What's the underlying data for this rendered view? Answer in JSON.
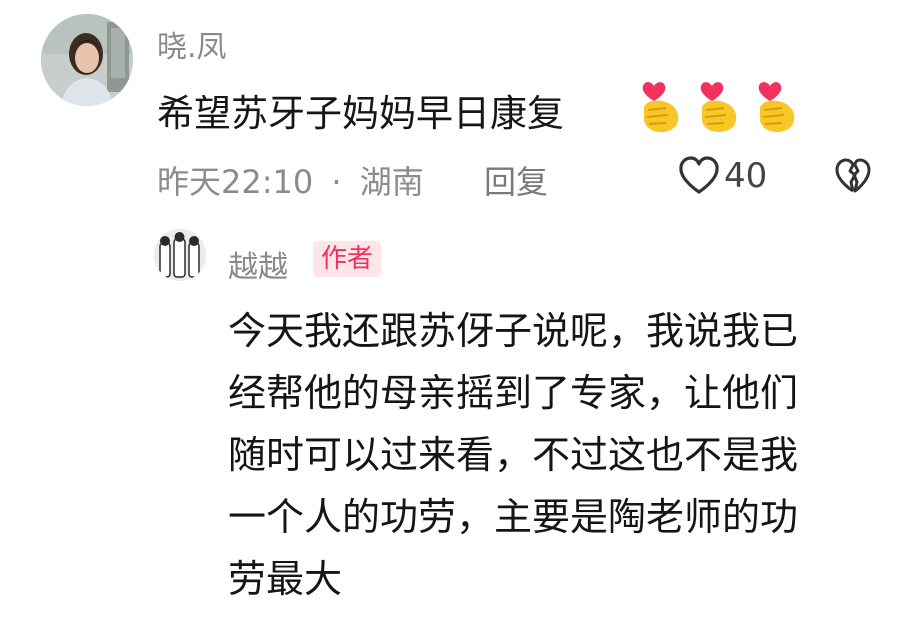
{
  "comment": {
    "username": "晓.凤",
    "text": "希望苏牙子妈妈早日康复",
    "emojis": [
      "finger-heart-emoji",
      "finger-heart-emoji",
      "finger-heart-emoji"
    ],
    "time": "昨天22:10",
    "separator": "·",
    "location": "湖南",
    "reply_label": "回复",
    "like_count": "40"
  },
  "reply": {
    "username": "越越",
    "badge": "作者",
    "lines": [
      "今天我还跟苏伢子说呢，我说我已",
      "经帮他的母亲摇到了专家，让他们",
      "随时可以过来看，不过这也不是我",
      "一个人的功劳，主要是陶老师的功",
      "劳最大"
    ]
  },
  "colors": {
    "badge_text": "#f2325e",
    "badge_bg": "#fde5ea",
    "meta_gray": "#8c8c8c",
    "emoji_yellow": "#f8c627",
    "emoji_heart": "#f2325e"
  }
}
